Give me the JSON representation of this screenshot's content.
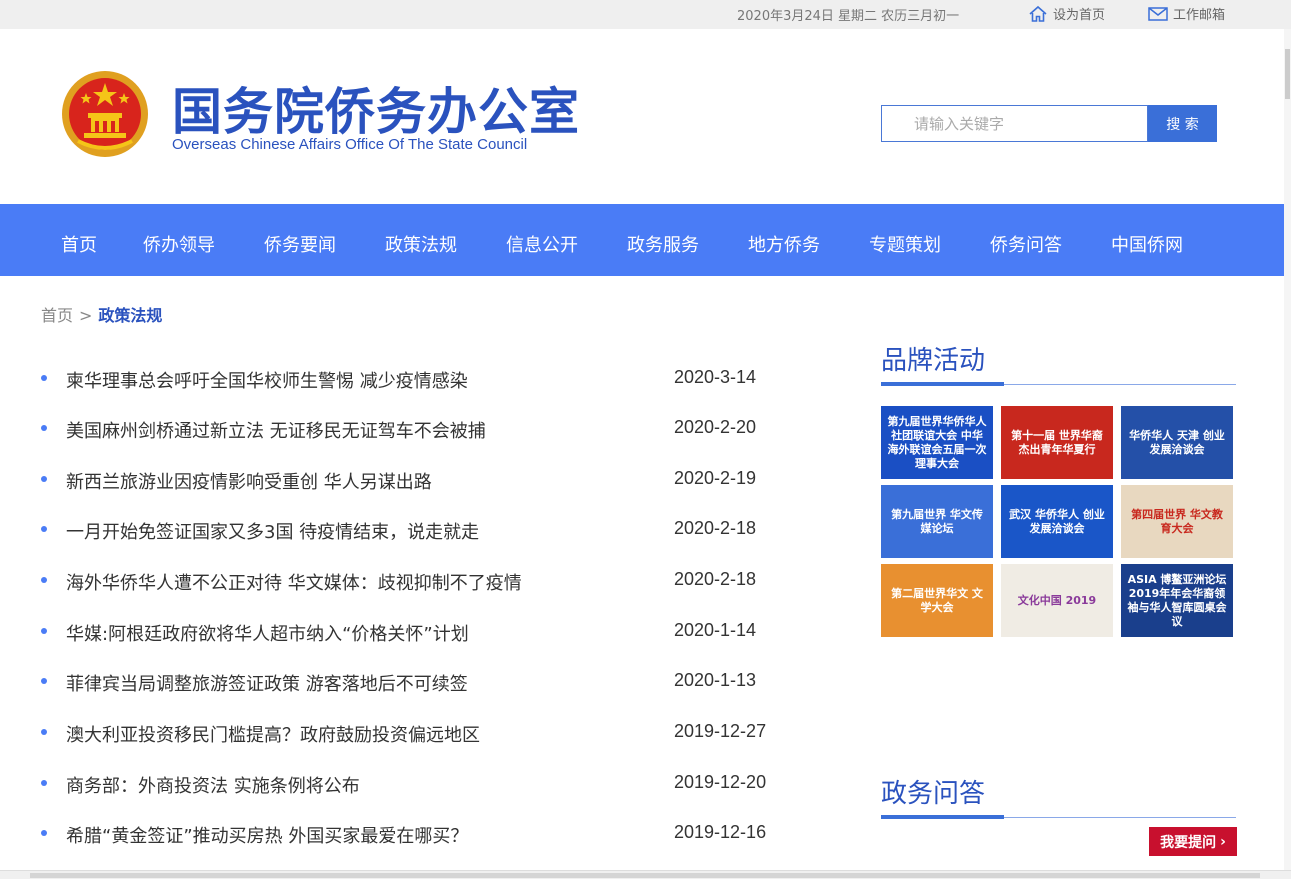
{
  "topbar": {
    "date_text": "2020年3月24日 星期二 农历三月初一",
    "set_home_label": "设为首页",
    "work_mail_label": "工作邮箱"
  },
  "header": {
    "title": "国务院侨务办公室",
    "subtitle": "Overseas Chinese Affairs Office Of The State Council",
    "search_placeholder": "请输入关键字",
    "search_button": "搜 索"
  },
  "nav": {
    "items": [
      "首页",
      "侨办领导",
      "侨务要闻",
      "政策法规",
      "信息公开",
      "政务服务",
      "地方侨务",
      "专题策划",
      "侨务问答",
      "中国侨网"
    ]
  },
  "breadcrumb": {
    "home": "首页",
    "separator": ">",
    "current": "政策法规"
  },
  "news": [
    {
      "title": "柬华理事总会呼吁全国华校师生警惕 减少疫情感染",
      "date": "2020-3-14"
    },
    {
      "title": "美国麻州剑桥通过新立法 无证移民无证驾车不会被捕",
      "date": "2020-2-20"
    },
    {
      "title": "新西兰旅游业因疫情影响受重创 华人另谋出路",
      "date": "2020-2-19"
    },
    {
      "title": "一月开始免签证国家又多3国 待疫情结束，说走就走",
      "date": "2020-2-18"
    },
    {
      "title": "海外华侨华人遭不公正对待 华文媒体：歧视抑制不了疫情",
      "date": "2020-2-18"
    },
    {
      "title": "华媒:阿根廷政府欲将华人超市纳入“价格关怀”计划",
      "date": "2020-1-14"
    },
    {
      "title": "菲律宾当局调整旅游签证政策 游客落地后不可续签",
      "date": "2020-1-13"
    },
    {
      "title": "澳大利亚投资移民门槛提高？政府鼓励投资偏远地区",
      "date": "2019-12-27"
    },
    {
      "title": "商务部：外商投资法 实施条例将公布",
      "date": "2019-12-20"
    },
    {
      "title": "希腊“黄金签证”推动买房热 外国买家最爱在哪买？",
      "date": "2019-12-16"
    }
  ],
  "brand": {
    "title": "品牌活动",
    "tiles": [
      {
        "text": "第九届世界华侨华人社团联谊大会 中华海外联谊会五届一次理事大会",
        "bg": "#1a4fc4"
      },
      {
        "text": "第十一届 世界华裔杰出青年华夏行",
        "bg": "#c8281e"
      },
      {
        "text": "华侨华人 天津 创业发展洽谈会",
        "bg": "#2450a8"
      },
      {
        "text": "第九届世界 华文传媒论坛",
        "bg": "#3a6fd8"
      },
      {
        "text": "武汉 华侨华人 创业发展洽谈会",
        "bg": "#1a56c8"
      },
      {
        "text": "第四届世界 华文教育大会",
        "bg": "#e8d8c0"
      },
      {
        "text": "第二届世界华文 文学大会",
        "bg": "#e89030"
      },
      {
        "text": "文化中国 2019",
        "bg": "#f0ece4"
      },
      {
        "text": "ASIA 博鳌亚洲论坛 2019年年会华裔领袖与华人智库圆桌会议",
        "bg": "#1a3f8c"
      }
    ]
  },
  "qa": {
    "title": "政务问答",
    "ask_button": "我要提问"
  },
  "colors": {
    "nav_bg": "#4a7cf6",
    "brand_blue": "#2a52be",
    "ask_red": "#c8102e"
  }
}
